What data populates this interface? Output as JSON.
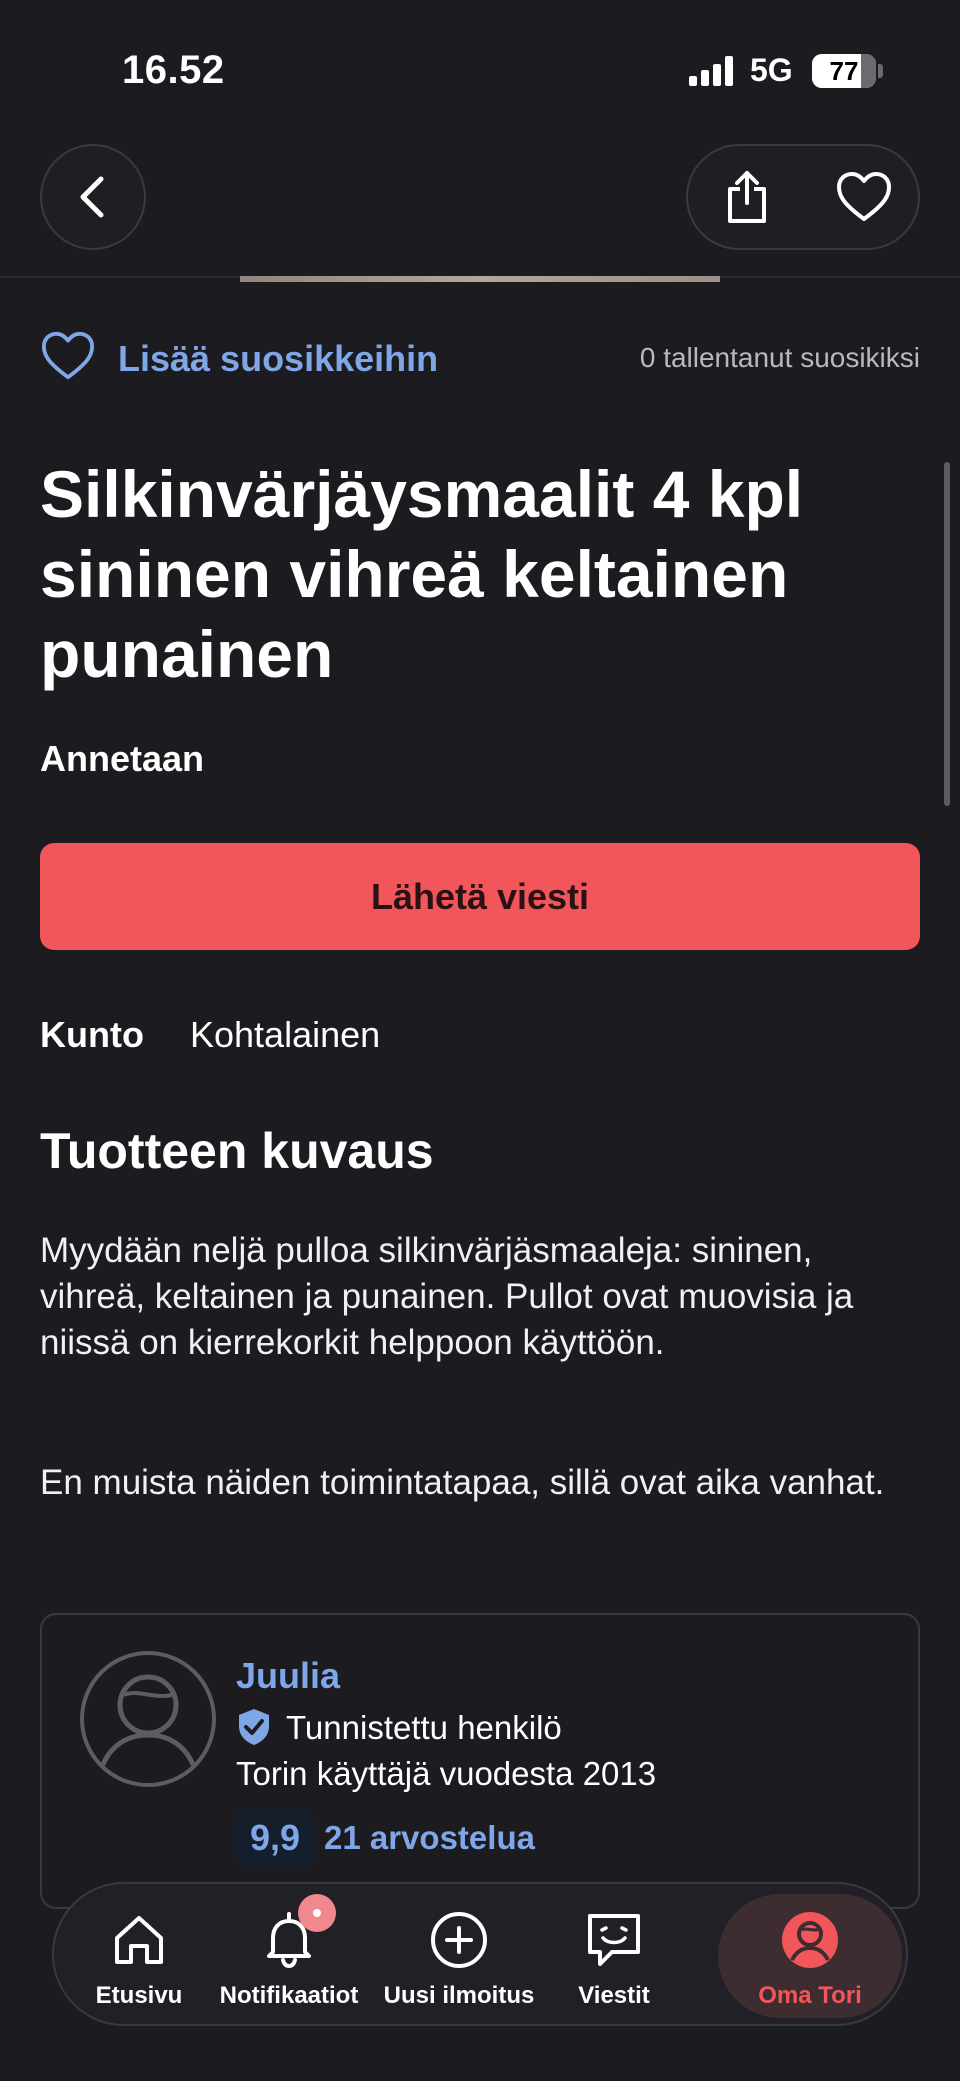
{
  "status": {
    "time": "16.52",
    "network": "5G",
    "battery": "77",
    "battery_level": 0.77
  },
  "favorite": {
    "label": "Lisää suosikkeihin",
    "count_text": "0 tallentanut suosikiksi"
  },
  "listing": {
    "title": "Silkinvärjäysmaalit 4 kpl sininen vihreä keltainen punainen",
    "price_text": "Annetaan",
    "send_button": "Lähetä viesti",
    "condition_label": "Kunto",
    "condition_value": "Kohtalainen",
    "description_heading": "Tuotteen kuvaus",
    "description_paragraphs": [
      "Myydään neljä pulloa silkinvärjäsmaaleja: sininen, vihreä, keltainen ja punainen. Pullot ovat muovisia ja niissä on kierrekorkit helppoon käyttöön.",
      "En muista näiden toimintatapaa, sillä ovat aika vanhat."
    ]
  },
  "seller": {
    "name": "Juulia",
    "verified_text": "Tunnistettu henkilö",
    "member_since": "Torin käyttäjä vuodesta 2013",
    "rating": "9,9",
    "reviews": "21 arvostelua"
  },
  "tabs": [
    {
      "label": "Etusivu",
      "icon": "home-icon"
    },
    {
      "label": "Notifikaatiot",
      "icon": "bell-icon"
    },
    {
      "label": "Uusi ilmoitus",
      "icon": "plus-circle-icon"
    },
    {
      "label": "Viestit",
      "icon": "chat-icon"
    },
    {
      "label": "Oma Tori",
      "icon": "profile-icon",
      "active": true
    }
  ],
  "colors": {
    "background": "#1c1b20",
    "accent_blue": "#7fa6e6",
    "primary_red": "#f2555a",
    "active_tab": "#f2555a"
  }
}
